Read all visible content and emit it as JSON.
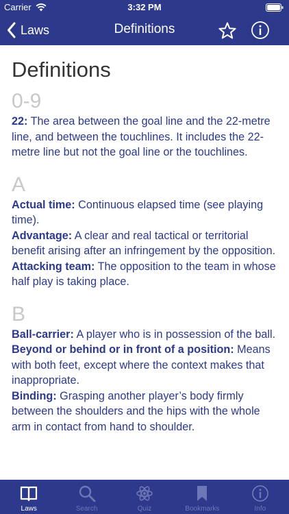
{
  "status": {
    "carrier": "Carrier",
    "time": "3:32 PM"
  },
  "nav": {
    "back_label": "Laws",
    "title": "Definitions",
    "icons": [
      "chevron-left-icon",
      "star-icon",
      "info-icon"
    ]
  },
  "content": {
    "title": "Definitions",
    "sections": [
      {
        "heading": "0-9",
        "definitions": [
          {
            "term": "22:",
            "text": " The area between the goal line and the 22-metre line, and between the touchlines. It includes the 22-metre line but not the goal line or the touchlines."
          }
        ]
      },
      {
        "heading": "A",
        "definitions": [
          {
            "term": "Actual time:",
            "text": " Continuous elapsed time (see playing time)."
          },
          {
            "term": "Advantage:",
            "text": " A clear and real tactical or territorial benefit arising after an infringement by the opposition."
          },
          {
            "term": "Attacking team:",
            "text": " The opposition to the team in whose half play is taking place."
          }
        ]
      },
      {
        "heading": "B",
        "definitions": [
          {
            "term": "Ball-carrier:",
            "text": " A player who is in possession of the ball."
          },
          {
            "term": "Beyond or behind or in front of a position:",
            "text": " Means with both feet, except where the context makes that inappropriate."
          },
          {
            "term": "Binding:",
            "text": " Grasping another player’s body firmly between the shoulders and the hips with the whole arm in contact from hand to shoulder."
          }
        ]
      }
    ]
  },
  "tabs": [
    {
      "label": "Laws",
      "icon": "book-icon",
      "active": true
    },
    {
      "label": "Search",
      "icon": "search-icon",
      "active": false
    },
    {
      "label": "Quiz",
      "icon": "atom-icon",
      "active": false
    },
    {
      "label": "Bookmarks",
      "icon": "bookmark-icon",
      "active": false
    },
    {
      "label": "Info",
      "icon": "info-icon",
      "active": false
    }
  ],
  "colors": {
    "primary": "#2d3a8c",
    "heading_gray": "#c8c8c8",
    "inactive_tab": "#6d77b8"
  }
}
